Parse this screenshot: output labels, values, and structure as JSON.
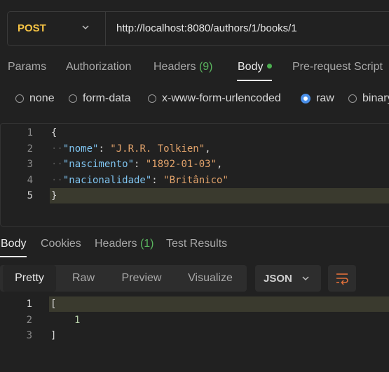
{
  "request": {
    "method": "POST",
    "url": "http://localhost:8080/authors/1/books/1"
  },
  "request_tabs": {
    "params": "Params",
    "authorization": "Authorization",
    "headers_label": "Headers",
    "headers_count": "(9)",
    "body": "Body",
    "prerequest": "Pre-request Script"
  },
  "body_types": {
    "none": "none",
    "form_data": "form-data",
    "urlencoded": "x-www-form-urlencoded",
    "raw": "raw",
    "binary": "binary",
    "selected": "raw"
  },
  "request_body": {
    "line_numbers": [
      "1",
      "2",
      "3",
      "4",
      "5"
    ],
    "open_brace": "{",
    "close_brace": "}",
    "fields": [
      {
        "key": "\"nome\"",
        "value": "\"J.R.R. Tolkien\"",
        "trail": ","
      },
      {
        "key": "\"nascimento\"",
        "value": "\"1892-01-03\"",
        "trail": ","
      },
      {
        "key": "\"nacionalidade\"",
        "value": "\"Britânico\"",
        "trail": ""
      }
    ]
  },
  "response_tabs": {
    "body": "Body",
    "cookies": "Cookies",
    "headers_label": "Headers",
    "headers_count": "(1)",
    "test_results": "Test Results"
  },
  "response_view": {
    "modes": [
      "Pretty",
      "Raw",
      "Preview",
      "Visualize"
    ],
    "selected_mode": "Pretty",
    "format": "JSON"
  },
  "response_body": {
    "line_numbers": [
      "1",
      "2",
      "3"
    ],
    "open": "[",
    "value": "1",
    "close": "]"
  },
  "colors": {
    "method": "#f5c344",
    "accent_green": "#4cb050",
    "radio_selected": "#4a8fe8",
    "json_key": "#7fc4f0",
    "json_string": "#e2a36b",
    "json_number": "#b5cea8"
  }
}
